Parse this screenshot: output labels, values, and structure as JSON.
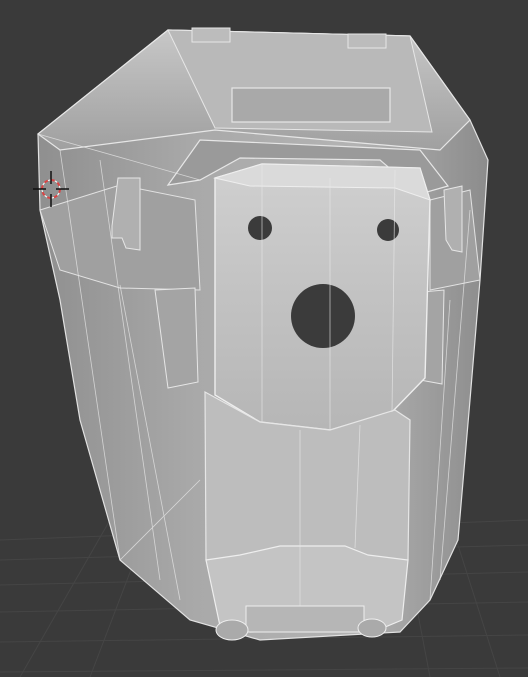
{
  "app": {
    "kind": "3d-viewport",
    "mode": "edit-mode-wireframe-overlay"
  },
  "viewport": {
    "background_color": "#3a3a3a",
    "grid_color": "#444444",
    "model_base_color": "#a7a7a7",
    "model_light_color": "#c9c9c9",
    "model_dark_color": "#8a8a8a",
    "edge_color": "#e6e6e6",
    "hole_color": "#3b3b3b",
    "cursor_ring_color": "#d94444",
    "cursor_cross_color": "#111111"
  },
  "icons": {
    "cursor": "3d-cursor-icon"
  }
}
